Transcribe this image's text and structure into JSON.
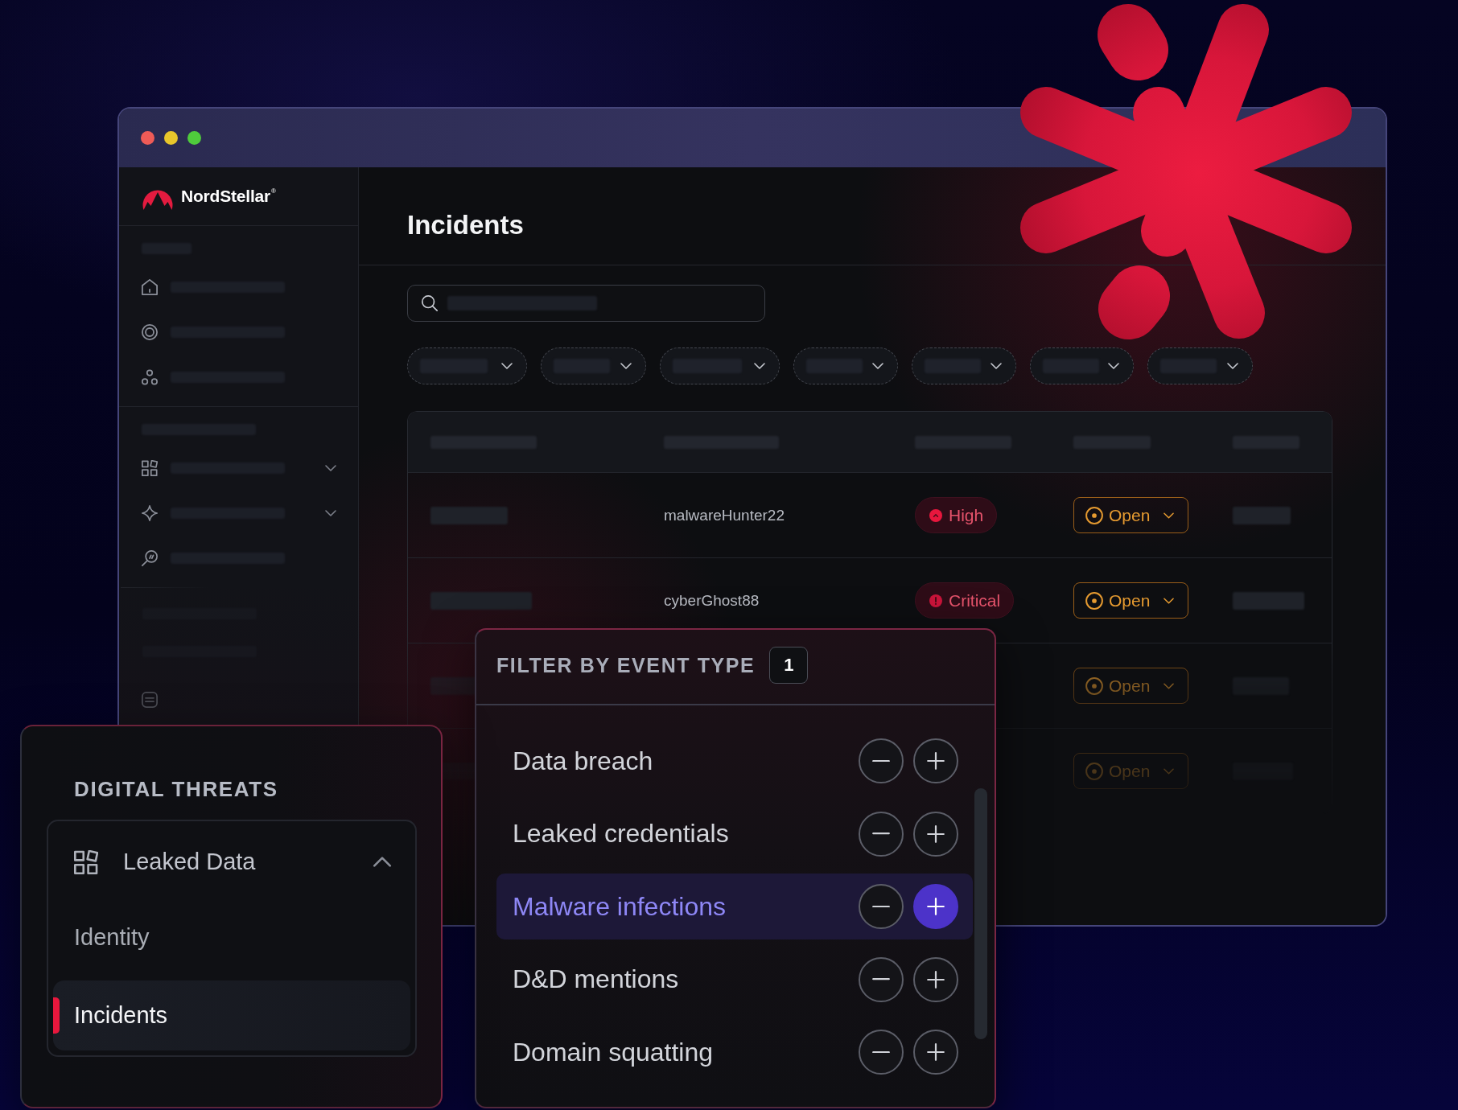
{
  "sidebar": {
    "logo": "NordStellar$^{®}$",
    "sections": [
      {
        "items": [
          {
            "kind": "link"
          },
          {
            "kind": "link"
          },
          {
            "kind": "link"
          }
        ]
      },
      {
        "items": [
          {
            "kind": "group",
            "expanded": false
          },
          {
            "kind": "group",
            "expanded": false
          },
          {
            "kind": "link"
          }
        ]
      }
    ]
  },
  "page": {
    "title": "Incidents"
  },
  "table": {
    "rows": [
      {
        "column_2": "malwareHunter22",
        "column_3": {
          "label": "High",
          "kind": "high"
        },
        "column_4": "Open"
      },
      {
        "column_2": "cyberGhost88",
        "column_3": {
          "label": "Critical",
          "kind": "critical"
        },
        "column_4": "Open"
      },
      {
        "column_4": "Open"
      },
      {
        "column_4": "Open"
      }
    ]
  },
  "filter_popup": {
    "title": "FILTER BY EVENT TYPE",
    "count": "1",
    "event_types": [
      {
        "label": "Data breach",
        "included": false
      },
      {
        "label": "Leaked credentials",
        "included": false
      },
      {
        "label": "Malware infections",
        "included": true
      },
      {
        "label": "D&D mentions",
        "included": false
      },
      {
        "label": "Domain squatting",
        "included": false
      }
    ]
  },
  "digital_threats": {
    "title": "DIGITAL THREATS",
    "group": {
      "label": "Leaked Data",
      "expanded": true,
      "children": [
        {
          "label": "Identity",
          "selected": false
        },
        {
          "label": "Incidents",
          "selected": true
        }
      ]
    }
  }
}
